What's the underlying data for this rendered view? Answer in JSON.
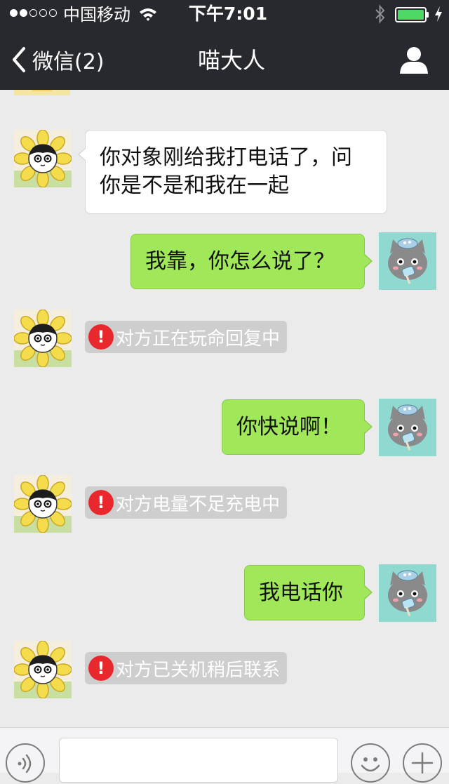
{
  "status_bar": {
    "carrier": "中国移动",
    "time": "下午7:01",
    "signal_strength": 2,
    "signal_total": 5,
    "battery_color": "#4cd964"
  },
  "header": {
    "back_label": "微信(2)",
    "title": "喵大人",
    "right_icon": "person-icon"
  },
  "theme": {
    "header_bg": "#28292e",
    "chat_bg": "#ebebeb",
    "outgoing_bubble": "#a0e759",
    "incoming_bubble": "#ffffff",
    "system_pill": "#cecece",
    "error_red": "#e8282d"
  },
  "messages": [
    {
      "type": "incoming",
      "sender_avatar": "sunflower-cat-avatar",
      "lines": [
        "你对象刚给我打电话了，问",
        "你是不是和我在一起"
      ]
    },
    {
      "type": "outgoing",
      "sender_avatar": "gray-cat-avatar",
      "text": "我靠，你怎么说了？"
    },
    {
      "type": "system",
      "icon": "error-icon",
      "icon_text": "!",
      "text": "对方正在玩命回复中"
    },
    {
      "type": "outgoing",
      "sender_avatar": "gray-cat-avatar",
      "text": "你快说啊！"
    },
    {
      "type": "system",
      "icon": "error-icon",
      "icon_text": "!",
      "text": "对方电量不足充电中"
    },
    {
      "type": "outgoing",
      "sender_avatar": "gray-cat-avatar",
      "text": "我电话你"
    },
    {
      "type": "system",
      "icon": "error-icon",
      "icon_text": "!",
      "text": "对方已关机稍后联系"
    }
  ],
  "input_bar": {
    "placeholder": "",
    "left_icon": "voice-icon",
    "emoji_icon": "emoji-icon",
    "plus_icon": "plus-icon"
  }
}
